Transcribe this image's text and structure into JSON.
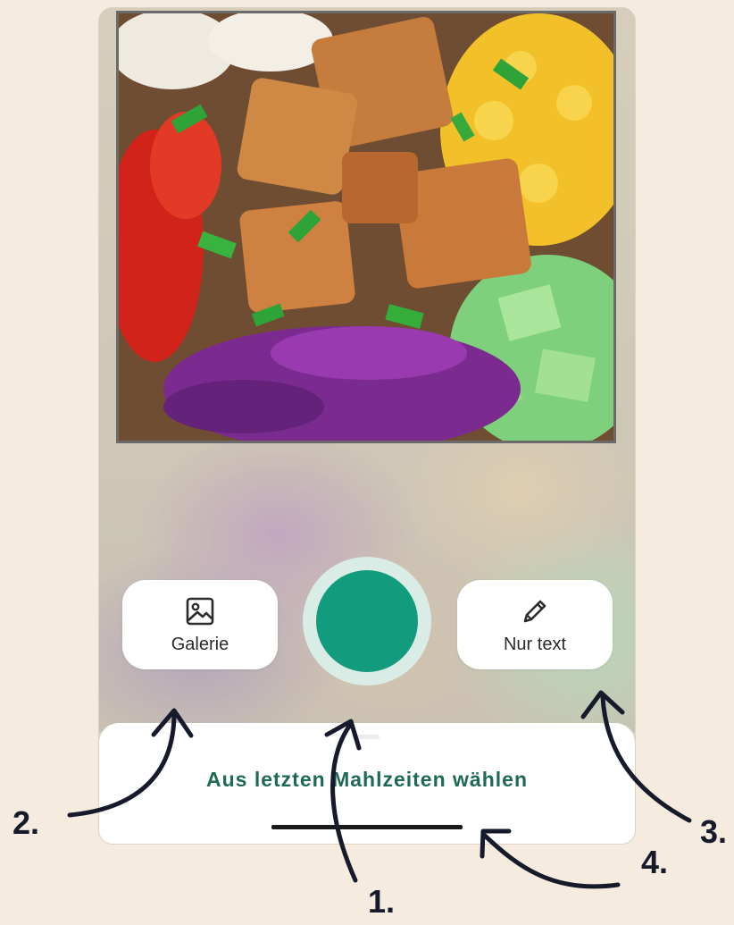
{
  "camera_screen": {
    "gallery_button": {
      "label": "Galerie",
      "icon": "image-icon"
    },
    "text_only_button": {
      "label": "Nur text",
      "icon": "pencil-icon"
    },
    "shutter_button": {
      "color": "#139b7e",
      "ring_color": "#d9ede6"
    },
    "recent_meals_link": "Aus letzten Mahlzeiten wählen"
  },
  "annotations": {
    "callout_1": "1.",
    "callout_2": "2.",
    "callout_3": "3.",
    "callout_4": "4."
  },
  "colors": {
    "page_background": "#f5ecdf",
    "accent_green": "#139b7e",
    "link_text": "#1f6a56",
    "arrow_ink": "#161a2a"
  }
}
